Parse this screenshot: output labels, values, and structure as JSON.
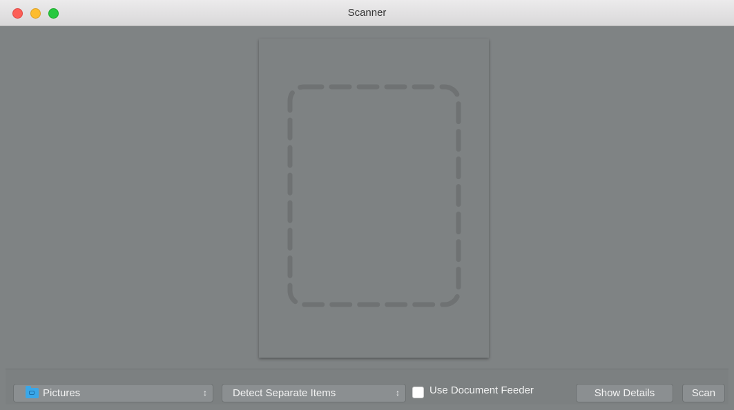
{
  "window": {
    "title": "Scanner",
    "traffic_lights": {
      "close_color": "#fc5f57",
      "minimize_color": "#fdbc2e",
      "zoom_color": "#27c840"
    }
  },
  "scan_area": {
    "placeholder_icon": "dashed-rounded-rectangle"
  },
  "toolbar": {
    "destination": {
      "value": "Pictures",
      "icon": "folder-icon"
    },
    "mode": {
      "value": "Detect Separate Items"
    },
    "document_feeder": {
      "label": "Use Document Feeder",
      "checked": false
    },
    "show_details_label": "Show Details",
    "scan_label": "Scan"
  }
}
